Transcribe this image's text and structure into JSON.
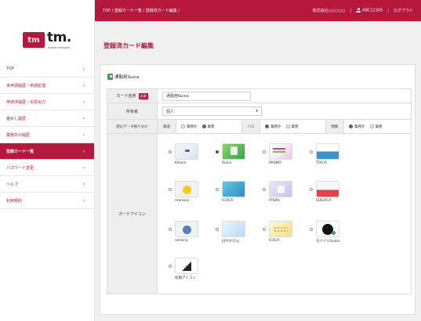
{
  "logo": {
    "mark": "tm",
    "name": "tm.",
    "subtitle": "transit manager"
  },
  "nav": [
    {
      "label": "TOP",
      "active": false
    },
    {
      "label": "未申請履歴・申請処理",
      "active": false
    },
    {
      "label": "申請済履歴・伝票出力",
      "active": false
    },
    {
      "label": "差戻し履歴",
      "active": false
    },
    {
      "label": "業務外の履歴",
      "active": false
    },
    {
      "label": "登録カード一覧",
      "active": true
    },
    {
      "label": "パスワード変更",
      "active": false
    },
    {
      "label": "ヘルプ",
      "active": false
    },
    {
      "label": "利用規約",
      "active": false
    }
  ],
  "topbar": {
    "breadcrumb": "TOP / 登録カード一覧 / 登録済カード編集 /",
    "company": "株式会社○○○○○",
    "user_id": "ABC12345",
    "logout": "ログアウト"
  },
  "page_title": "登録済カード編集",
  "panel": {
    "card_title": "通勤用Suica",
    "fields": {
      "card_name_label": "カード名称",
      "required_badge": "必須",
      "card_name_value": "通勤用Suica",
      "owner_label": "所有者",
      "owner_value": "個人",
      "owner_arrow": "▾"
    },
    "read_setting": {
      "label": "読込データ振り分け",
      "groups": [
        {
          "name": "鉄道",
          "options": [
            "業務外",
            "業務"
          ],
          "selected": 1
        },
        {
          "name": "バス",
          "options": [
            "業務外",
            "業務"
          ],
          "selected": 0
        },
        {
          "name": "物販",
          "options": [
            "業務外",
            "業務"
          ],
          "selected": 0
        }
      ]
    },
    "icon_label": "カードアイコン",
    "icons": [
      {
        "name": "Kitaca",
        "selected": false
      },
      {
        "name": "Suica",
        "selected": true
      },
      {
        "name": "PASMO",
        "selected": false
      },
      {
        "name": "TOICA",
        "selected": false
      },
      {
        "name": "manaca",
        "selected": false
      },
      {
        "name": "ICOCA",
        "selected": false
      },
      {
        "name": "PiTaPa",
        "selected": false
      },
      {
        "name": "SUGOCA",
        "selected": false
      },
      {
        "name": "nimoca",
        "selected": false
      },
      {
        "name": "はやかけん",
        "selected": false
      },
      {
        "name": "ICSCA",
        "selected": false
      },
      {
        "name": "モバイルSuica",
        "selected": false
      },
      {
        "name": "初期アイコン",
        "selected": false
      }
    ]
  },
  "colors": {
    "brand": "#b5173d"
  }
}
